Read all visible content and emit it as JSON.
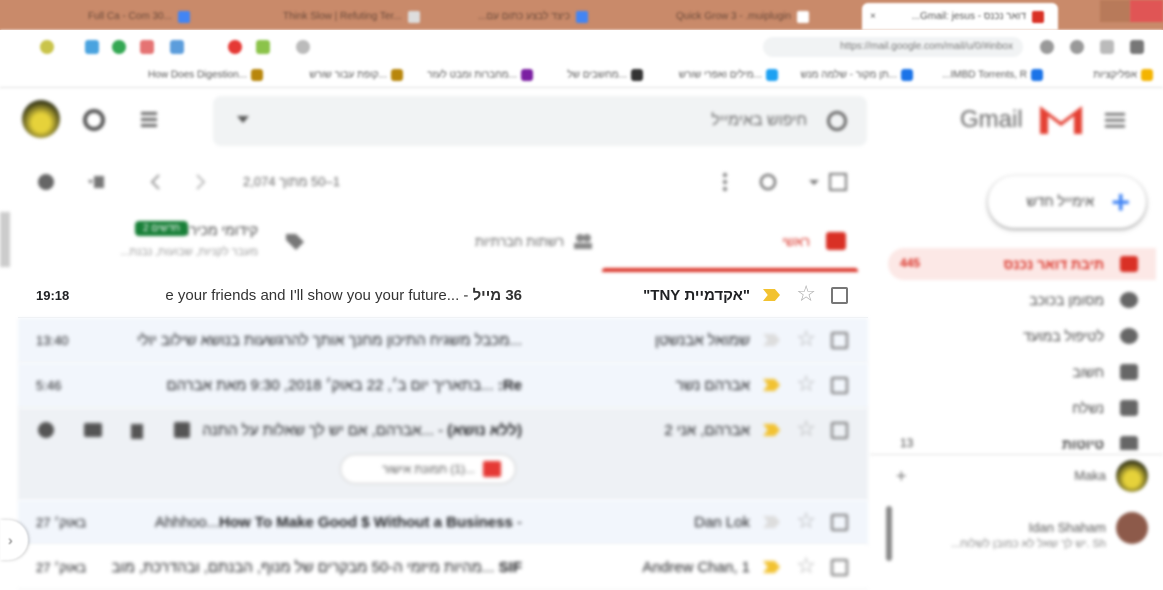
{
  "browser": {
    "tabs": [
      {
        "title": "דואר נכנס - Gmail: jesus...",
        "active": true,
        "color": "#d93025"
      },
      {
        "title": "Quick Grow 3 - .muiplugin",
        "active": false,
        "color": "#4285f4"
      },
      {
        "title": "...כיצד לבצע כתום עם",
        "active": false,
        "color": "#4285f4"
      },
      {
        "title": "Think Slow | Refuting Ter...",
        "active": false,
        "color": "#aaa"
      },
      {
        "title": "Full Ca - Com 30...",
        "active": false,
        "color": "#4285f4"
      }
    ],
    "omnibox": "https://mail.google.com/mail/u/0/#inbox",
    "bookmarks": [
      {
        "label": "אפליקציות",
        "color": "#f4b400"
      },
      {
        "label": "IMBD Torrents, R...",
        "color": "#1a73e8"
      },
      {
        "label": "...תן מקור - שלמה מנש",
        "color": "#1a73e8"
      },
      {
        "label": "...מילים ואפרי שורש",
        "color": "#1da1f2"
      },
      {
        "label": "...מחשבים של",
        "color": "#333"
      },
      {
        "label": "...מחברות ומבט לעזר",
        "color": "#7b1fa2"
      },
      {
        "label": "...קופת עבור שורש",
        "color": "#b8860b"
      },
      {
        "label": "...How Does Digestion",
        "color": "#b8860b"
      }
    ]
  },
  "gmail": {
    "logo_text": "Gmail",
    "search_placeholder": "חיפוש באימייל",
    "toolbar": {
      "count_text": "1–50 מתוך 2,074"
    },
    "categories": {
      "primary": "ראשי",
      "social": "רשתות חברתיות",
      "promotions": "קידומי מכירות",
      "promotions_badge": "2 חדשים",
      "promotions_sub": "...מעבר לקניות, שבועות, נבנת"
    },
    "rows": [
      {
        "sender": "\"אקדמיית TNY\"",
        "subject_bold": "36 מייל",
        "subject_rest": " - ...e your friends and I'll show you your future",
        "time": "19:18",
        "important": true,
        "sharp": true
      },
      {
        "sender": "שמואל אבנשטן",
        "subject_bold": "",
        "subject_rest": "...מכבל משגיח התיכון מחנך אותך להרגשעות בנושא שילוב יולי",
        "time": "13:40",
        "important": false,
        "sharp": false
      },
      {
        "sender": "אברהם נשר",
        "subject_bold": "Re: ",
        "subject_rest": "...בתאריך יום ב׳, 22 באוק׳ 2018, 9:30 מאת אברהם",
        "time": "5:46",
        "important": true,
        "sharp": false
      },
      {
        "sender": "אברהם, אני 2",
        "subject_bold": "(ללא נושא)",
        "subject_rest": " - ...אברהם, אם יש לך שאלות על התנה",
        "time": "",
        "important": true,
        "sharp": false
      },
      {
        "sender": "Dan Lok",
        "subject_bold": "How To Make Good $ Without a Business",
        "subject_rest": " - Ahhhoo...",
        "time": "27 באוק׳",
        "important": false,
        "sharp": false
      },
      {
        "sender": "1 ,Andrew Chan",
        "subject_bold": "SIF ",
        "subject_rest": "...מהיות מיזמי ה-50 מבקרים של מנוף, הבנתם, ובהדרכת, מוב",
        "time": "27 באוק׳",
        "important": true,
        "sharp": false
      }
    ],
    "attachment_chip": "...(1) תמונת אישור",
    "sidebar": {
      "compose": "אימייל חדש",
      "items": [
        {
          "label": "תיבת דואר נכנס",
          "count": "445",
          "active": true
        },
        {
          "label": "מסומן בכוכב",
          "count": "",
          "active": false
        },
        {
          "label": "לטיפול במועד",
          "count": "",
          "active": false
        },
        {
          "label": "חשוב",
          "count": "",
          "active": false
        },
        {
          "label": "נשלח",
          "count": "",
          "active": false
        },
        {
          "label": "טיוטות",
          "count": "13",
          "active": false
        }
      ],
      "hangouts": [
        {
          "name": "Maka",
          "sub": ""
        },
        {
          "name": "Idan Shaham",
          "sub": "...יש לך שאל לא כמובן לשלוח. Sh"
        }
      ]
    }
  }
}
